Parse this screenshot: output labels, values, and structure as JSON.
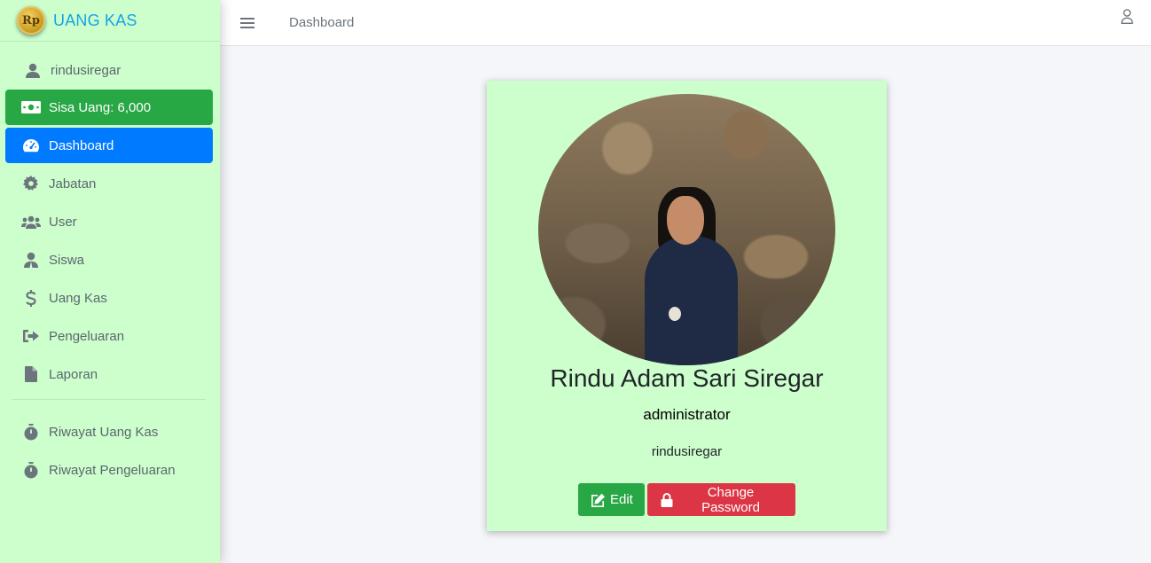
{
  "brand": {
    "logo_text": "Rp",
    "title": "UANG KAS"
  },
  "sidebar": {
    "user": {
      "label": "rindusiregar",
      "icon": "user-icon"
    },
    "saldo": {
      "label": "Sisa Uang: 6,000",
      "icon": "money-icon"
    },
    "items": [
      {
        "label": "Dashboard",
        "icon": "tachometer-icon",
        "active": true
      },
      {
        "label": "Jabatan",
        "icon": "gear-icon"
      },
      {
        "label": "User",
        "icon": "users-icon"
      },
      {
        "label": "Siswa",
        "icon": "student-icon"
      },
      {
        "label": "Uang Kas",
        "icon": "dollar-icon"
      },
      {
        "label": "Pengeluaran",
        "icon": "sign-out-icon"
      },
      {
        "label": "Laporan",
        "icon": "file-icon"
      }
    ],
    "history": [
      {
        "label": "Riwayat Uang Kas",
        "icon": "stopwatch-icon"
      },
      {
        "label": "Riwayat Pengeluaran",
        "icon": "stopwatch-icon"
      }
    ]
  },
  "topbar": {
    "title": "Dashboard",
    "menu_icon": "hamburger-icon",
    "user_icon": "user-outline-icon"
  },
  "profile": {
    "name": "Rindu Adam Sari Siregar",
    "role": "administrator",
    "username": "rindusiregar",
    "edit_label": "Edit",
    "change_password_label": "Change Password"
  },
  "colors": {
    "sidebar_bg": "#ccffcc",
    "brand_text": "#17a2e8",
    "saldo_bg": "#28a745",
    "active_bg": "#007bff",
    "edit_btn": "#28a745",
    "password_btn": "#dc3545"
  }
}
